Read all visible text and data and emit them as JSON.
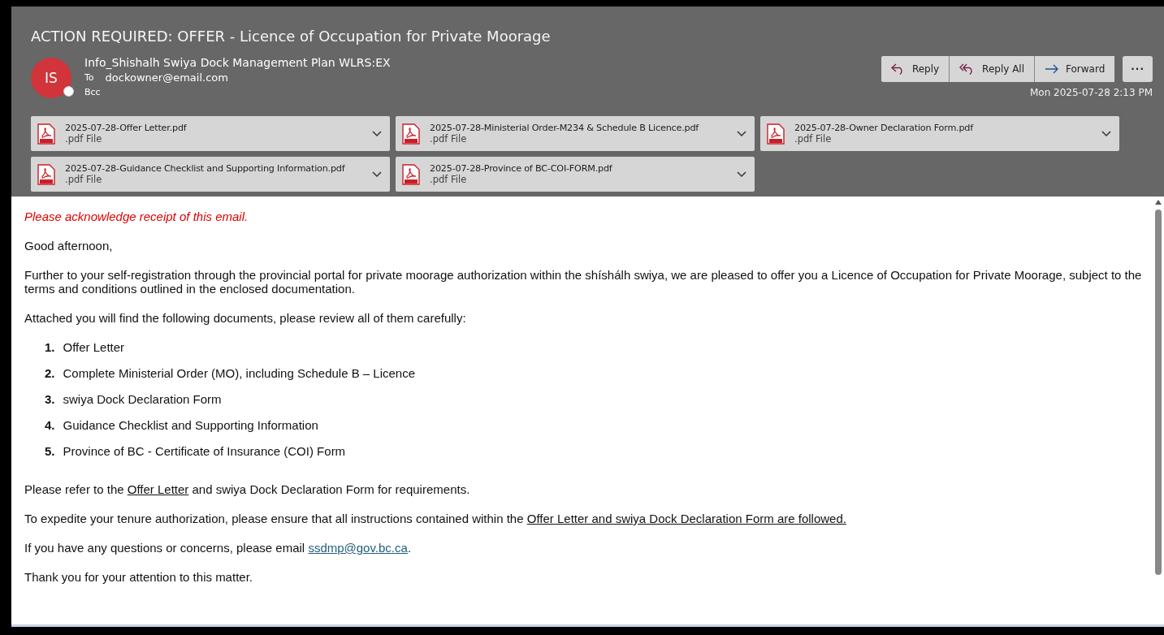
{
  "subject": "ACTION REQUIRED: OFFER - Licence of Occupation for Private Moorage",
  "sender": {
    "initials": "IS",
    "name": "Info_Shishalh Swiya Dock Management Plan WLRS:EX",
    "online": false
  },
  "recipients": [
    {
      "label": "To",
      "value": "dockowner@email.com"
    },
    {
      "label": "Bcc"
    }
  ],
  "actions": [
    {
      "kind": "reply",
      "label": "Reply"
    },
    {
      "kind": "reply-all",
      "label": "Reply All"
    },
    {
      "kind": "forward",
      "label": "Forward"
    },
    {
      "kind": "more",
      "label": "···"
    }
  ],
  "date": "Mon 2025-07-28 2:13 PM",
  "attachments": [
    {
      "name": "2025-07-28-Offer Letter.pdf",
      "type": ".pdf File"
    },
    {
      "name": "2025-07-28-Ministerial Order-M234 & Schedule B Licence.pdf",
      "type": ".pdf File"
    },
    {
      "name": "2025-07-28-Owner Declaration Form.pdf",
      "type": ".pdf File"
    },
    {
      "name": "2025-07-28-Guidance Checklist and Supporting Information.pdf",
      "type": ".pdf File"
    },
    {
      "name": "2025-07-28-Province of BC-COI-FORM.pdf",
      "type": ".pdf File"
    }
  ],
  "body": [
    {
      "kind": "notice",
      "text": "Please acknowledge receipt of this email."
    },
    {
      "kind": "paragraph",
      "text": "Good afternoon,"
    },
    {
      "kind": "paragraph",
      "text": "Further to your self-registration through the provincial portal for private moorage authorization within the shíshálh swiya, we are pleased to offer you a Licence of Occupation for Private Moorage, subject to the terms and conditions outlined in the enclosed documentation."
    },
    {
      "kind": "paragraph",
      "text": "Attached you will find the following documents, please review all of them carefully:"
    },
    {
      "kind": "list",
      "items": [
        {
          "number": "1.",
          "text": "Offer Letter"
        },
        {
          "number": "2.",
          "text": "Complete Ministerial Order (MO), including Schedule B – Licence"
        },
        {
          "number": "3.",
          "text": "swiya Dock Declaration Form"
        },
        {
          "number": "4.",
          "text": "Guidance Checklist and Supporting Information"
        },
        {
          "number": "5.",
          "text": "Province of BC - Certificate of Insurance (COI) Form"
        }
      ]
    },
    {
      "kind": "segments",
      "parts": [
        {
          "kind": "text",
          "text": "Please refer to the "
        },
        {
          "kind": "underline",
          "text": "Offer Letter"
        },
        {
          "kind": "text",
          "text": " and swiya Dock Declaration Form for requirements."
        }
      ]
    },
    {
      "kind": "segments",
      "parts": [
        {
          "kind": "text",
          "text": "To expedite your tenure authorization, please ensure that all instructions contained within the "
        },
        {
          "kind": "underline",
          "text": "Offer Letter and swiya Dock Declaration Form are followed."
        }
      ]
    },
    {
      "kind": "segments",
      "parts": [
        {
          "kind": "text",
          "text": "If you have any questions or concerns, please email "
        },
        {
          "kind": "link",
          "text": "ssdmp@gov.bc.ca"
        },
        {
          "kind": "text",
          "text": "."
        }
      ]
    },
    {
      "kind": "paragraph",
      "text": "Thank you for your attention to this matter."
    }
  ]
}
